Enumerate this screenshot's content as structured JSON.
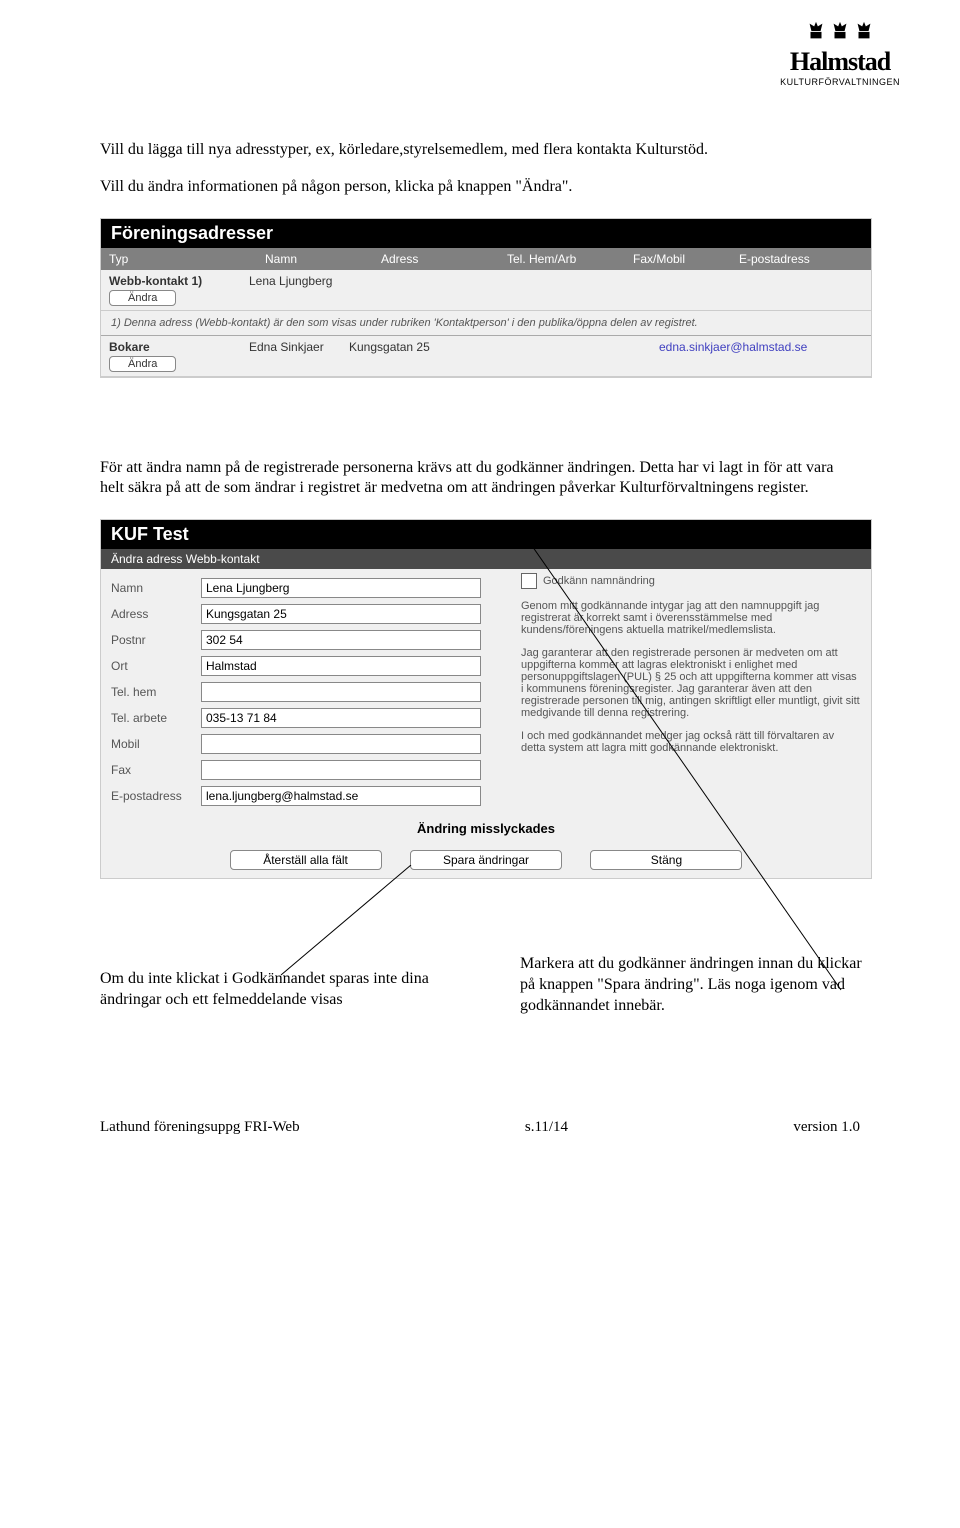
{
  "logo": {
    "name": "Halmstad",
    "sub": "KULTURFÖRVALTNINGEN"
  },
  "intro": {
    "p1": "Vill du lägga till nya adresstyper, ex, körledare,styrelsemedlem, med flera kontakta Kulturstöd.",
    "p2": "Vill du ändra informationen på någon person, klicka på knappen \"Ändra\"."
  },
  "addressPanel": {
    "title": "Föreningsadresser",
    "headers": {
      "typ": "Typ",
      "namn": "Namn",
      "adress": "Adress",
      "tel": "Tel. Hem/Arb",
      "fax": "Fax/Mobil",
      "epost": "E-postadress"
    },
    "rows": [
      {
        "typLabel": "Webb-kontakt 1)",
        "btn": "Ändra",
        "namn": "Lena Ljungberg",
        "adress": "",
        "tel": "",
        "fax": "",
        "epost": ""
      },
      {
        "typLabel": "Bokare",
        "btn": "Ändra",
        "namn": "Edna Sinkjaer",
        "adress": "Kungsgatan 25",
        "tel": "",
        "fax": "",
        "epost": "edna.sinkjaer@halmstad.se"
      }
    ],
    "note": "1) Denna adress (Webb-kontakt) är den som visas under rubriken 'Kontaktperson' i den publika/öppna delen av registret."
  },
  "midText": "För att ändra namn på de registrerade personerna krävs att du godkänner ändringen. Detta har vi lagt in för att vara helt säkra på att de som ändrar i registret är medvetna om att ändringen påverkar Kulturförvaltningens register.",
  "editPanel": {
    "title": "KUF Test",
    "sub": "Ändra adress Webb-kontakt",
    "fields": {
      "namn": {
        "label": "Namn",
        "value": "Lena Ljungberg"
      },
      "adress": {
        "label": "Adress",
        "value": "Kungsgatan 25"
      },
      "postnr": {
        "label": "Postnr",
        "value": "302 54"
      },
      "ort": {
        "label": "Ort",
        "value": "Halmstad"
      },
      "telhem": {
        "label": "Tel. hem",
        "value": ""
      },
      "telarb": {
        "label": "Tel. arbete",
        "value": "035-13 71 84"
      },
      "mobil": {
        "label": "Mobil",
        "value": ""
      },
      "fax": {
        "label": "Fax",
        "value": ""
      },
      "epost": {
        "label": "E-postadress",
        "value": "lena.ljungberg@halmstad.se"
      }
    },
    "approve": {
      "checkboxLabel": "Godkänn namnändring",
      "p1": "Genom mitt godkännande intygar jag att den namnuppgift jag registrerat är korrekt samt i överensstämmelse med kundens/föreningens aktuella matrikel/medlemslista.",
      "p2": "Jag garanterar att den registrerade personen är medveten om att uppgifterna kommer att lagras elektroniskt i enlighet med personuppgiftslagen (PUL) § 25 och att uppgifterna kommer att visas i kommunens föreningsregister. Jag garanterar även att den registrerade personen till mig, antingen skriftligt eller muntligt, givit sitt medgivande till denna registrering.",
      "p3": "I och med godkännandet medger jag också rätt till förvaltaren av detta system att lagra mitt godkännande elektroniskt."
    },
    "status": "Ändring misslyckades",
    "buttons": {
      "reset": "Återställ alla fält",
      "save": "Spara ändringar",
      "close": "Stäng"
    }
  },
  "annotations": {
    "left": "Om du inte klickat i Godkännandet sparas inte dina ändringar och ett felmeddelande visas",
    "right": "Markera att du godkänner ändringen innan du klickar på knappen \"Spara ändring\". Läs noga igenom vad godkännandet innebär."
  },
  "footer": {
    "left": "Lathund föreningsuppg FRI-Web",
    "center": "s.11/14",
    "right": "version 1.0"
  }
}
